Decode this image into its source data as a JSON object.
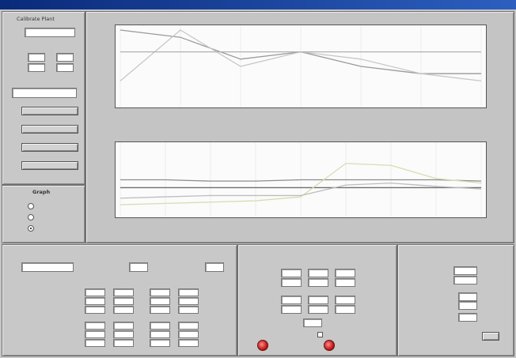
{
  "window": {
    "title": ""
  },
  "left_panel": {
    "top_title": "Calibrate Plant",
    "top_field": "",
    "group_labels": [
      "",
      ""
    ],
    "small_fields": [
      "",
      "",
      "",
      ""
    ],
    "mid_title": "",
    "mid_field": "",
    "buttons": [
      "",
      "",
      "",
      ""
    ],
    "graph_title": "Graph",
    "graph_options": [
      "",
      "",
      ""
    ]
  },
  "top_chart": {
    "headers": [
      "",
      "",
      ""
    ],
    "ylabel": "",
    "y_ticks": [
      "",
      "",
      "",
      "",
      "",
      "",
      ""
    ],
    "x_ticks": [
      "",
      "",
      "",
      "",
      "",
      "",
      ""
    ]
  },
  "bottom_chart": {
    "headers": [
      "",
      "",
      "",
      "",
      ""
    ],
    "ylabel": "",
    "xlabel": "",
    "y_ticks": [
      "",
      "",
      "",
      "",
      "",
      ""
    ],
    "x_ticks": [
      "",
      "",
      "",
      "",
      "",
      "",
      "",
      "",
      ""
    ]
  },
  "chart_data": [
    {
      "type": "line",
      "series": [
        {
          "color": "#9a9a9a",
          "x": [
            0,
            1,
            2,
            3,
            4,
            5,
            6
          ],
          "y": [
            10,
            9,
            6,
            7,
            5,
            4,
            4
          ]
        },
        {
          "color": "#c7c7c7",
          "x": [
            0,
            1,
            2,
            3,
            4,
            5,
            6
          ],
          "y": [
            3,
            10,
            5,
            7,
            6,
            4,
            3
          ]
        },
        {
          "color": "#b0b0b0",
          "x": [
            0,
            1,
            2,
            3,
            4,
            5,
            6
          ],
          "y": [
            7,
            7,
            7,
            7,
            7,
            7,
            7
          ]
        }
      ],
      "ylim": [
        0,
        10
      ]
    },
    {
      "type": "line",
      "series": [
        {
          "color": "#8c8c8c",
          "x": [
            0,
            1,
            2,
            3,
            4,
            5,
            6,
            7,
            8
          ],
          "y": [
            50,
            50,
            48,
            48,
            50,
            50,
            50,
            50,
            48
          ]
        },
        {
          "color": "#6e6e6e",
          "x": [
            0,
            1,
            2,
            3,
            4,
            5,
            6,
            7,
            8
          ],
          "y": [
            38,
            38,
            38,
            38,
            38,
            38,
            38,
            38,
            38
          ]
        },
        {
          "color": "#d9dcb0",
          "x": [
            0,
            1,
            2,
            3,
            4,
            5,
            6,
            7,
            8
          ],
          "y": [
            12,
            14,
            16,
            18,
            24,
            75,
            72,
            52,
            45
          ]
        },
        {
          "color": "#bdbdbd",
          "x": [
            0,
            1,
            2,
            3,
            4,
            5,
            6,
            7,
            8
          ],
          "y": [
            22,
            24,
            26,
            26,
            26,
            42,
            45,
            40,
            36
          ]
        }
      ],
      "ylim": [
        0,
        100
      ]
    }
  ],
  "setpoints": {
    "title": "",
    "dropdown": "",
    "labels": [
      "",
      ""
    ],
    "fields": [
      "",
      ""
    ],
    "col_headers": [
      "",
      "",
      "",
      ""
    ],
    "row_labels": [
      "",
      "",
      "",
      "",
      "",
      ""
    ],
    "cells": [
      [
        "",
        "",
        "",
        ""
      ],
      [
        "",
        "",
        "",
        ""
      ],
      [
        "",
        "",
        "",
        ""
      ],
      [
        "",
        "",
        "",
        ""
      ],
      [
        "",
        "",
        "",
        ""
      ],
      [
        "",
        "",
        "",
        ""
      ]
    ]
  },
  "measure": {
    "col_headers": [
      [
        "",
        ""
      ],
      [
        "",
        ""
      ],
      [
        "",
        ""
      ]
    ],
    "row_labels": [
      "",
      "",
      "",
      "",
      ""
    ],
    "cells": [
      [
        "",
        "",
        ""
      ],
      [
        "",
        "",
        ""
      ],
      [
        "",
        "",
        ""
      ],
      [
        "",
        "",
        ""
      ]
    ],
    "led_labels": [
      "",
      ""
    ]
  },
  "operator": {
    "title": "",
    "row_labels": [
      "",
      "",
      "",
      "",
      "",
      ""
    ],
    "fields": [
      "",
      "",
      "",
      "",
      ""
    ],
    "units": [
      "",
      "",
      "",
      "",
      ""
    ],
    "bottom_label": "",
    "bottom_button": ""
  }
}
